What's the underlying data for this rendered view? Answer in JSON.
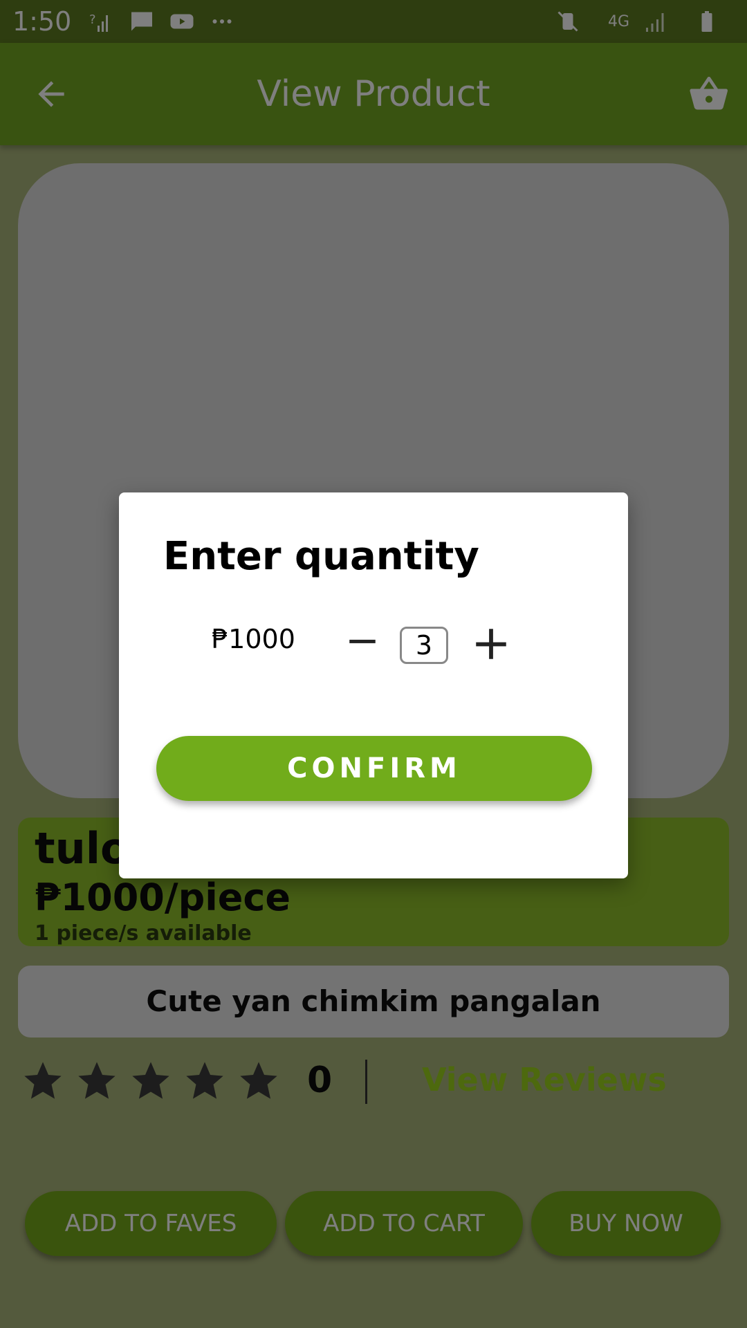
{
  "status_bar": {
    "time": "1:50",
    "left_icons": [
      "signal-question-icon",
      "message-icon",
      "youtube-icon",
      "more-dots-icon"
    ],
    "right_icons": [
      "mute-vibrate-icon",
      "4g-icon",
      "signal-icon",
      "battery-icon"
    ],
    "network": "4G"
  },
  "app_bar": {
    "title": "View Product",
    "back_icon": "arrow-back-icon",
    "cart_icon": "shopping-basket-icon"
  },
  "product": {
    "name": "tulo",
    "price": "₱1000/piece",
    "availability": "1 piece/s available",
    "description": "Cute yan chimkim pangalan",
    "rating_count": "0",
    "view_reviews": "View Reviews"
  },
  "actions": {
    "add_to_faves": "ADD TO FAVES",
    "add_to_cart": "ADD TO CART",
    "buy_now": "BUY NOW"
  },
  "dialog": {
    "title": "Enter quantity",
    "price": "₱1000",
    "quantity": "3",
    "confirm": "CONFIRM"
  },
  "colors": {
    "brand_green": "#72a723",
    "accent_lime": "#9bd21c",
    "dialog_bg": "#ffffff"
  }
}
